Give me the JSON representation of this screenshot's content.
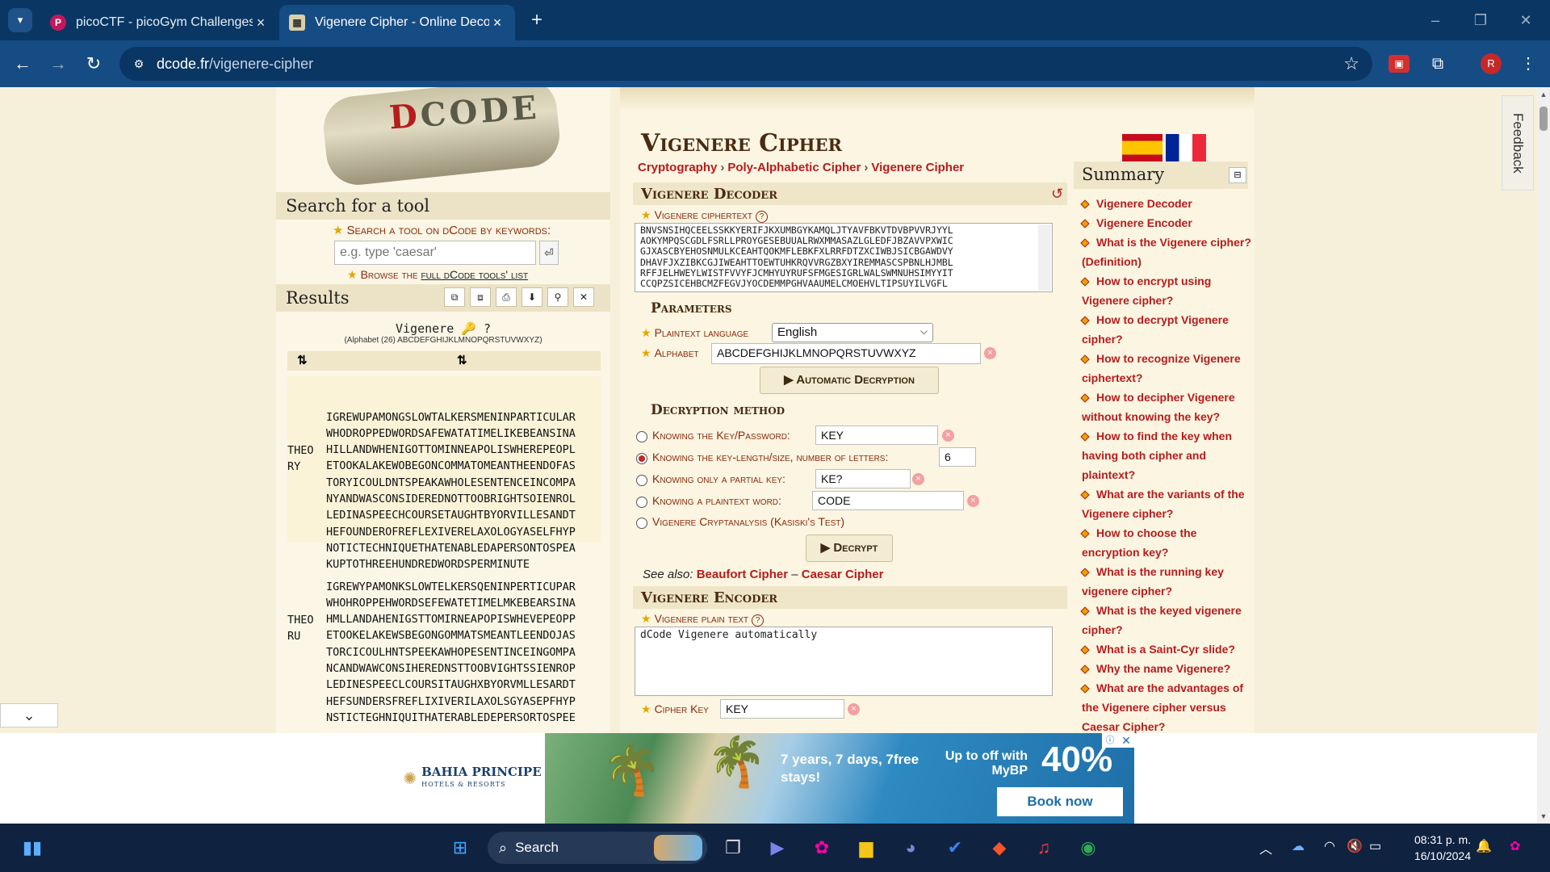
{
  "browser": {
    "tabs": [
      {
        "title": "picoCTF - picoGym Challenges",
        "favicon": "picoctf-favicon",
        "active": false
      },
      {
        "title": "Vigenere Cipher - Online Decod",
        "favicon": "dcode-favicon",
        "active": true
      }
    ],
    "url_host": "dcode.fr",
    "url_path": "/vigenere-cipher",
    "avatar_letter": "R"
  },
  "left": {
    "search_header": "Search for a tool",
    "search_label": "Search a tool on dCode by keywords:",
    "search_placeholder": "e.g. type 'caesar'",
    "browse_prefix": "Browse the ",
    "browse_link": "full dCode tools' list",
    "results_header": "Results",
    "result_title": "Vigenere 🔑 ?",
    "result_subtitle": "(Alphabet (26) ABCDEFGHIJKLMNOPQRSTUVWXYZ)",
    "col1": "⇅",
    "col2": "⇅",
    "results": [
      {
        "key_lines": [
          "THEO",
          "RY"
        ],
        "lines": [
          "IGREWUPAMONGSLOWTALKERSMENINPARTICULAR",
          "WHODROPPEDWORDSAFEWATATIMELIKEBEANSINA",
          "HILLANDWHENIGOTTOMINNEAPOLISWHEREPEOPL",
          "ETOOKALAKEWOBEGONCOMMATOMEANTHEENDOFAS",
          "TORYICOULDNTSPEAKAWHOLESENTENCEINCOMPA",
          "NYANDWASCONSIDEREDNOTTOOBRIGHTSOIENROL",
          "LEDINASPEECHCOURSETAUGHTBYORVILLESANDT",
          "HEFOUNDEROFREFLEXIVERELAXOLOGYASELFHYP",
          "NOTICTECHNIQUETHATENABLEDAPERSONTOSPEA",
          "KUPTOTHREEHUNDREDWORDSPERMINUTE"
        ]
      },
      {
        "key_lines": [
          "THEO",
          "RU"
        ],
        "lines": [
          "IGREWYPAMONKSLOWTELKERSQENINPERTICUPAR",
          "WHOHROPPEHWORDSEFEWATETIMELMKEBEARSINA",
          "HMLLANDAHENIGSTTOMIRNEAPOPISWHEVEPEOPP",
          "ETOOKELAKEWSBEGONGOMMATSMEANTLEENDOJAS",
          "TORCICOULHNTSPEEKAWHOPESENTINCEINGOMPA",
          "NCANDWAWCONSIHEREDNSTTOOBVIGHTSSIENROP",
          "LEDINESPEECLCOURSITAUGHXBYORVMLLESARDT",
          "HEFSUNDERSFREFLIXIVERILAXOLSGYASEPFHYP",
          "NSTICTEGHNIQUITHATERABLEDEPERSORTOSPEE"
        ]
      }
    ]
  },
  "main": {
    "title": "Vigenere Cipher",
    "breadcrumbs": [
      "Cryptography",
      "Poly-Alphabetic Cipher",
      "Vigenere Cipher"
    ],
    "decoder_header": "Vigenere Decoder",
    "ciphertext_label": "Vigenere ciphertext",
    "ciphertext_lines": [
      "BNVSNSIHQCEELSSKKYERIFJKXUMBGYKAMQLJTYAVFBKVTDVBPVVRJYYL",
      "AOKYMPQSCGDLFSRLLPROYGESEBUUALRWXMMASAZLGLEDFJBZAVVPXWIC",
      "GJXASCBYEHOSNMULKCEAHTQOKMFLEBKFXLRRFDTZXCIWBJSICBGAWDVY",
      "DHAVFJXZIBKCGJIWEAHTTOEWTUHKRQVVRGZBXYIREMMASCSPBNLHJMBL",
      "RFFJELHWEYLWISTFVVYFJCMHYUYRUFSFMGESIGRLWALSWMNUHSIMYYIT",
      "CCQPZSICEHBCMZFEGVJYOCDEMMPGHVAAUMELCMOEHVLTIPSUYILVGFL"
    ],
    "parameters_header": "Parameters",
    "plaintext_language_label": "Plaintext language",
    "plaintext_language": "English",
    "alphabet_label": "Alphabet",
    "alphabet": "ABCDEFGHIJKLMNOPQRSTUVWXYZ",
    "auto_button": "▶ Automatic Decryption",
    "method_header": "Decryption method",
    "methods": [
      {
        "label": "Knowing the Key/Password:",
        "value": "KEY",
        "selected": false
      },
      {
        "label": "Knowing the key-length/size, number of letters:",
        "value": "6",
        "selected": true
      },
      {
        "label": "Knowing only a partial key:",
        "value": "KE?",
        "selected": false
      },
      {
        "label": "Knowing a plaintext word:",
        "value": "CODE",
        "selected": false
      },
      {
        "label": "Vigenere Cryptanalysis (Kasiski's Test)",
        "value": "",
        "selected": false
      }
    ],
    "decrypt_button": "▶ Decrypt",
    "see_also_label": "See also:",
    "see_also_links": [
      "Beaufort Cipher",
      "Caesar Cipher"
    ],
    "see_also_sep": "–",
    "encoder_header": "Vigenere Encoder",
    "plaintext_label": "Vigenere plain text",
    "plaintext_value": "dCode Vigenere automatically",
    "cipher_key_label": "Cipher Key",
    "cipher_key": "KEY"
  },
  "summary": {
    "header": "Summary",
    "items": [
      "Vigenere Decoder",
      "Vigenere Encoder",
      "What is the Vigenere cipher? (Definition)",
      "How to encrypt using Vigenere cipher?",
      "How to decrypt Vigenere cipher?",
      "How to recognize Vigenere ciphertext?",
      "How to decipher Vigenere without knowing the key?",
      "How to find the key when having both cipher and plaintext?",
      "What are the variants of the Vigenere cipher?",
      "How to choose the encryption key?",
      "What is the running key vigenere cipher?",
      "What is the keyed vigenere cipher?",
      "What is a Saint-Cyr slide?",
      "Why the name Vigenere?",
      "What are the advantages of the Vigenere cipher versus Caesar Cipher?"
    ]
  },
  "feedback": "Feedback",
  "ad": {
    "brand": "BAHIA PRINCIPE",
    "brand_sub": "HOTELS & RESORTS",
    "copy1": "7 years, 7 days, 7free stays!",
    "copy2": "Up to off with MyBP",
    "big": "40%",
    "cta": "Book now"
  },
  "taskbar": {
    "search": "Search",
    "time": "08:31 p. m.",
    "date": "16/10/2024"
  },
  "colors": {
    "accent": "#b71c1c",
    "tabbar": "#0a3663",
    "toolbar": "#164c84",
    "parchment": "#f6f0da"
  }
}
